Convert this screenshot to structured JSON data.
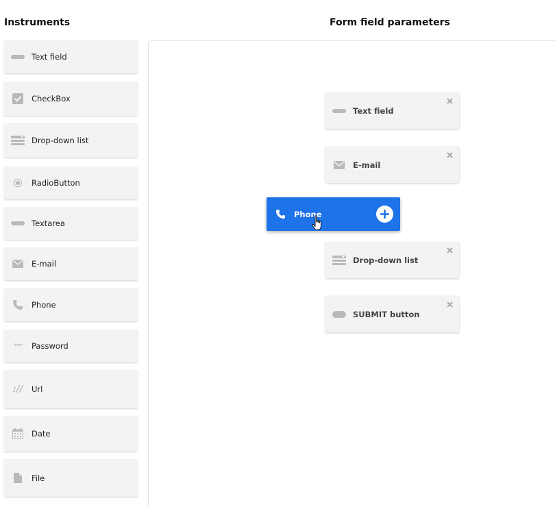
{
  "headings": {
    "instruments": "Instruments",
    "form": "Form field parameters"
  },
  "sidebar": {
    "items": [
      {
        "label": "Text field",
        "icon": "text-field-icon"
      },
      {
        "label": "CheckBox",
        "icon": "checkbox-icon"
      },
      {
        "label": "Drop-down list",
        "icon": "dropdown-icon"
      },
      {
        "label": "RadioButton",
        "icon": "radio-icon"
      },
      {
        "label": "Textarea",
        "icon": "textarea-icon"
      },
      {
        "label": "E-mail",
        "icon": "email-icon"
      },
      {
        "label": "Phone",
        "icon": "phone-icon"
      },
      {
        "label": "Password",
        "icon": "password-icon"
      },
      {
        "label": "Url",
        "icon": "url-icon"
      },
      {
        "label": "Date",
        "icon": "calendar-icon"
      },
      {
        "label": "File",
        "icon": "file-icon"
      }
    ]
  },
  "form": {
    "fields": [
      {
        "label": "Text field",
        "icon": "text-field-icon"
      },
      {
        "label": "E-mail",
        "icon": "email-icon"
      },
      {
        "label": "Drop-down list",
        "icon": "dropdown-icon"
      },
      {
        "label": "SUBMIT button",
        "icon": "submit-icon"
      }
    ],
    "dragging": {
      "label": "Phone",
      "icon": "phone-icon"
    }
  },
  "colors": {
    "accent": "#1e73e8",
    "card": "#f3f3f3",
    "icon": "#b9b9b9"
  }
}
